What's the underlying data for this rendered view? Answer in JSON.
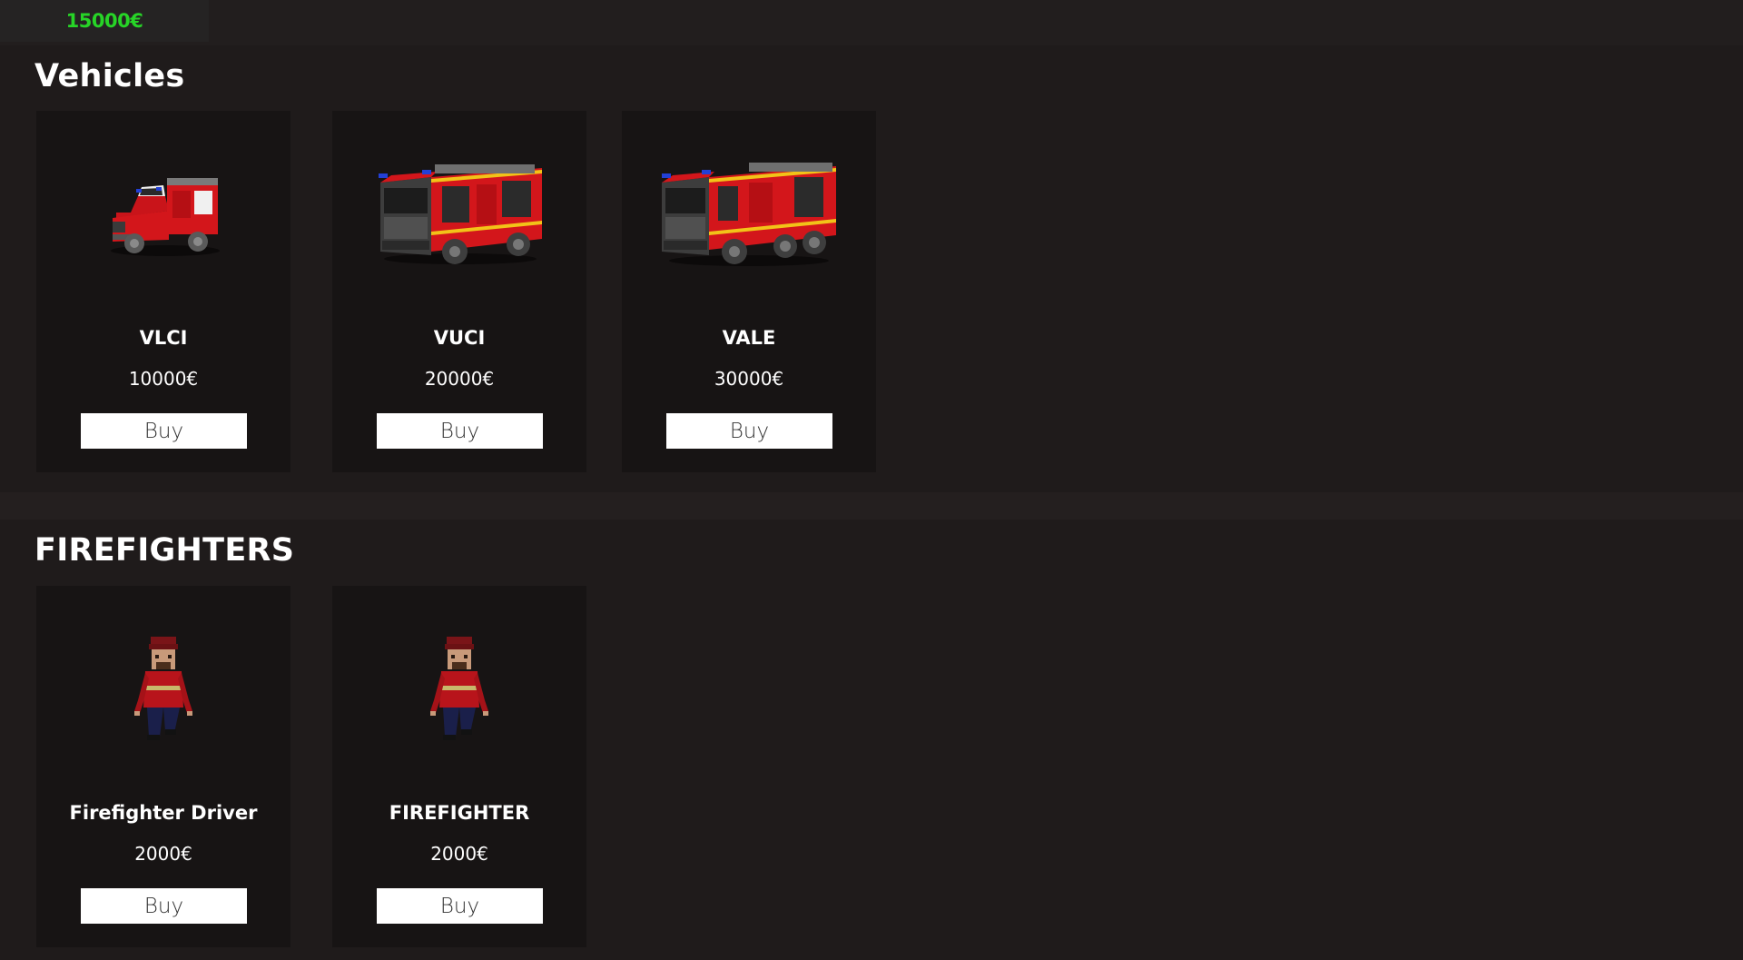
{
  "header": {
    "money": "15000€"
  },
  "colors": {
    "money": "#27d427",
    "background": "#1f1b1b",
    "card": "#171414",
    "truck_red": "#d3161b"
  },
  "vehicles": {
    "title": "Vehicles",
    "items": [
      {
        "name": "VLCI",
        "price": "10000€",
        "buy_label": "Buy",
        "icon": "fire-suv-icon"
      },
      {
        "name": "VUCI",
        "price": "20000€",
        "buy_label": "Buy",
        "icon": "fire-truck-icon"
      },
      {
        "name": "VALE",
        "price": "30000€",
        "buy_label": "Buy",
        "icon": "fire-truck-large-icon"
      }
    ]
  },
  "firefighters": {
    "title": "FIREFIGHTERS",
    "items": [
      {
        "name": "Firefighter Driver",
        "price": "2000€",
        "buy_label": "Buy",
        "icon": "firefighter-icon"
      },
      {
        "name": "FIREFIGHTER",
        "price": "2000€",
        "buy_label": "Buy",
        "icon": "firefighter-icon"
      }
    ]
  }
}
